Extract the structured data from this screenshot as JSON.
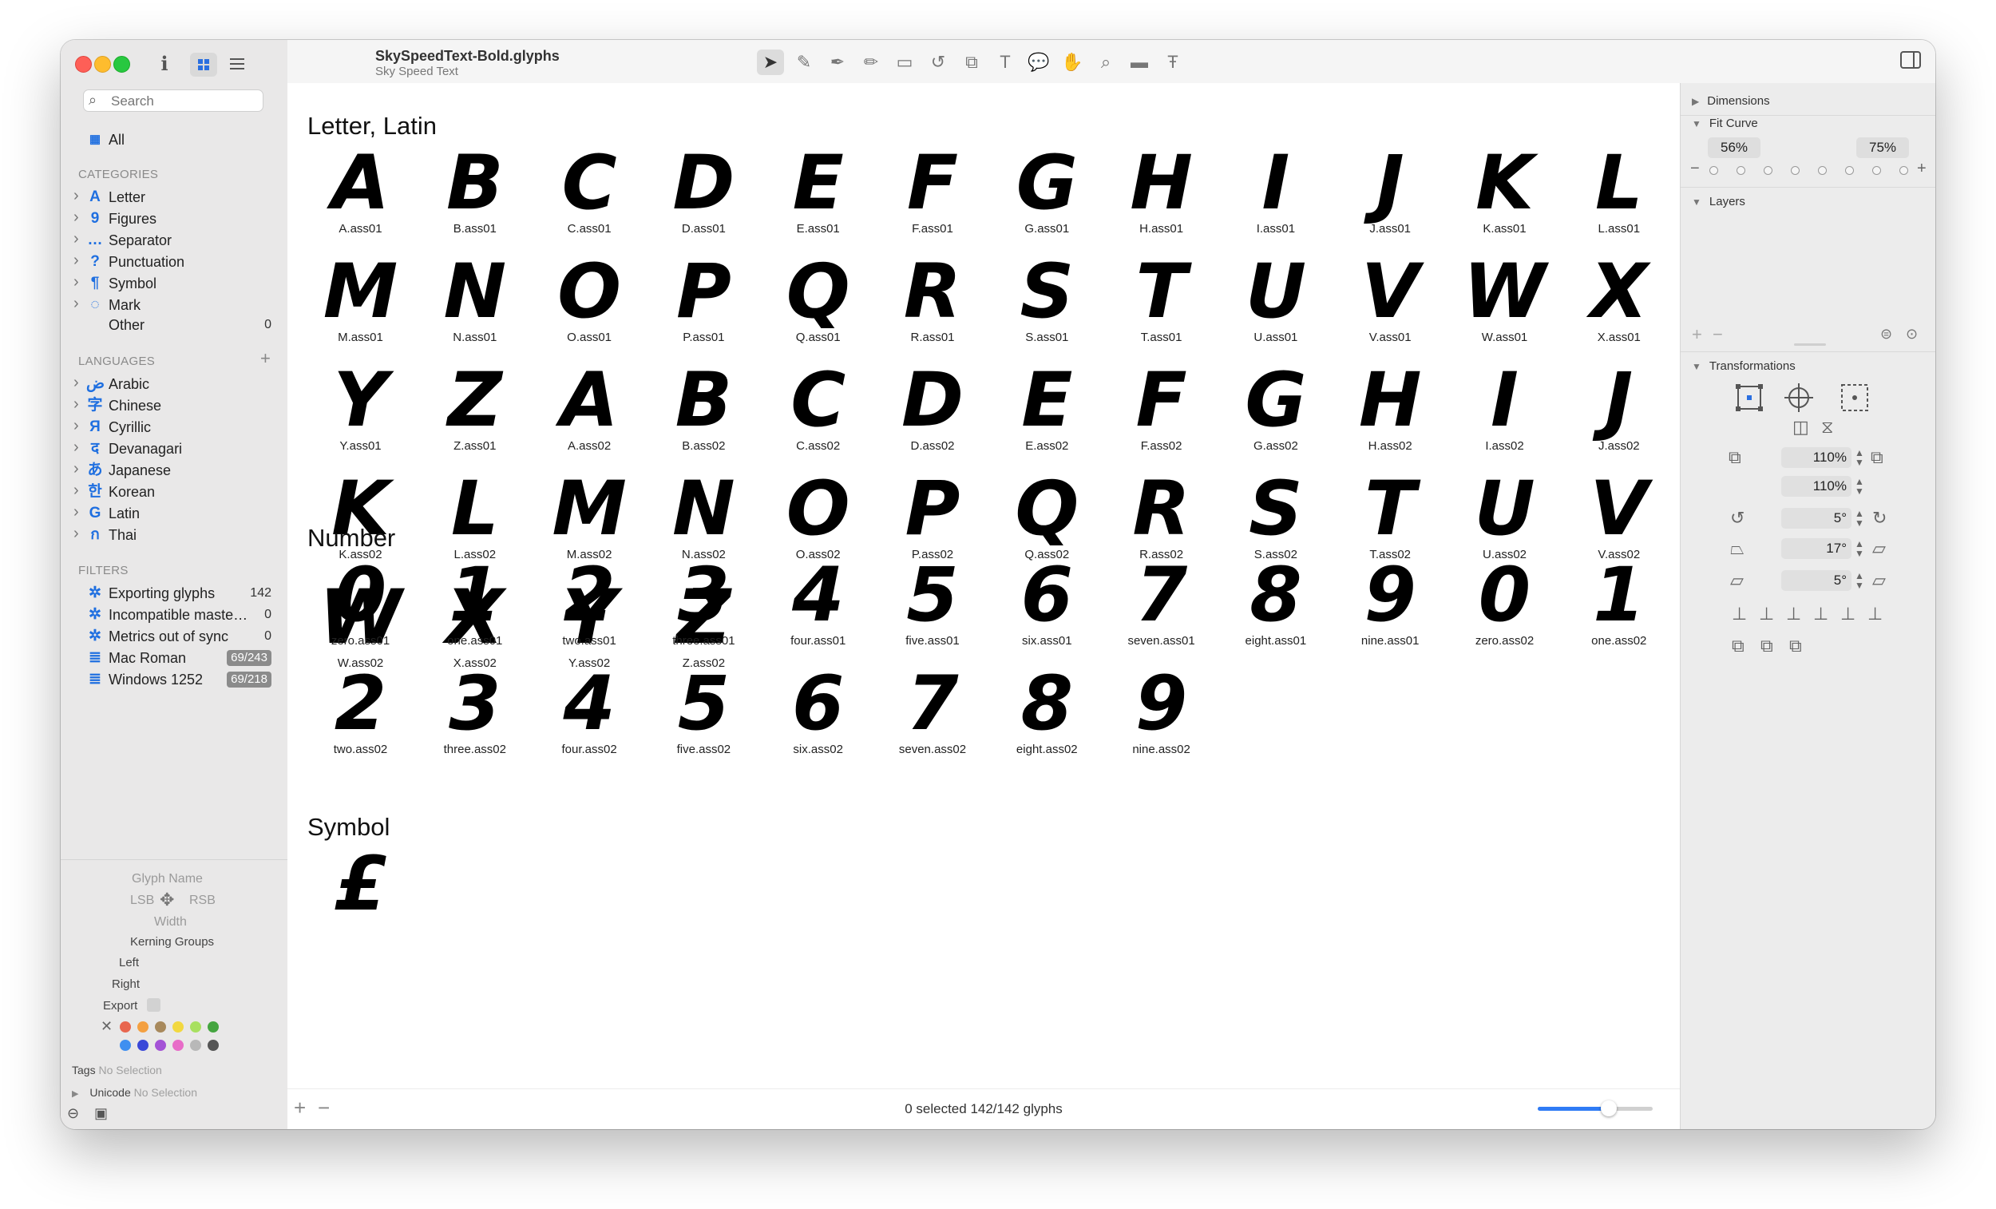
{
  "window": {
    "file_title": "SkySpeedText-Bold.glyphs",
    "font_name": "Sky Speed Text"
  },
  "sidebar": {
    "search_placeholder": "Search",
    "all_label": "All",
    "categories_heading": "CATEGORIES",
    "categories": [
      {
        "icon": "A",
        "label": "Letter",
        "icon_name": "letter-icon"
      },
      {
        "icon": "9",
        "label": "Figures",
        "icon_name": "figures-icon"
      },
      {
        "icon": "…",
        "label": "Separator",
        "icon_name": "separator-icon"
      },
      {
        "icon": "?",
        "label": "Punctuation",
        "icon_name": "punctuation-icon"
      },
      {
        "icon": "¶",
        "label": "Symbol",
        "icon_name": "symbol-icon"
      },
      {
        "icon": "◌",
        "label": "Mark",
        "icon_name": "mark-icon"
      }
    ],
    "other_label": "Other",
    "other_count": "0",
    "languages_heading": "LANGUAGES",
    "languages": [
      {
        "icon": "ض",
        "label": "Arabic"
      },
      {
        "icon": "字",
        "label": "Chinese"
      },
      {
        "icon": "Я",
        "label": "Cyrillic"
      },
      {
        "icon": "द",
        "label": "Devanagari"
      },
      {
        "icon": "あ",
        "label": "Japanese"
      },
      {
        "icon": "한",
        "label": "Korean"
      },
      {
        "icon": "G",
        "label": "Latin"
      },
      {
        "icon": "ก",
        "label": "Thai"
      }
    ],
    "filters_heading": "FILTERS",
    "filters": [
      {
        "label": "Exporting glyphs",
        "count": "142",
        "type": "count"
      },
      {
        "label": "Incompatible maste…",
        "count": "0",
        "type": "count"
      },
      {
        "label": "Metrics out of sync",
        "count": "0",
        "type": "count"
      },
      {
        "label": "Mac Roman",
        "count": "69/243",
        "type": "badge"
      },
      {
        "label": "Windows 1252",
        "count": "69/218",
        "type": "badge"
      }
    ],
    "info": {
      "glyph_name": "Glyph Name",
      "lsb": "LSB",
      "rsb": "RSB",
      "width": "Width",
      "kerning_groups": "Kerning Groups",
      "left": "Left",
      "right": "Right",
      "export": "Export",
      "tags_label": "Tags",
      "tags_value": "No Selection",
      "unicode_label": "Unicode",
      "unicode_value": "No Selection"
    },
    "color_labels": [
      "#e8664f",
      "#f4a041",
      "#a8895c",
      "#f2d840",
      "#a8e060",
      "#45a540",
      "#3f8ff0",
      "#3a48d8",
      "#a452d6",
      "#e86cc8",
      "#b8b8b8",
      "#555555"
    ]
  },
  "toolbar": {
    "tools": [
      "select-tool-icon",
      "select-all-layers-icon",
      "draw-tool-icon",
      "pencil-tool-icon",
      "primitives-icon",
      "rotate-icon",
      "scale-icon",
      "text-tool-icon",
      "annotation-icon",
      "hand-tool-icon",
      "zoom-icon",
      "measure-icon",
      "type-text-icon"
    ]
  },
  "main": {
    "categories": [
      {
        "title": "Letter, Latin",
        "glyphs": [
          {
            "char": "A",
            "name": "A.ass01"
          },
          {
            "char": "B",
            "name": "B.ass01"
          },
          {
            "char": "C",
            "name": "C.ass01"
          },
          {
            "char": "D",
            "name": "D.ass01"
          },
          {
            "char": "E",
            "name": "E.ass01"
          },
          {
            "char": "F",
            "name": "F.ass01"
          },
          {
            "char": "G",
            "name": "G.ass01"
          },
          {
            "char": "H",
            "name": "H.ass01"
          },
          {
            "char": "I",
            "name": "I.ass01"
          },
          {
            "char": "J",
            "name": "J.ass01"
          },
          {
            "char": "K",
            "name": "K.ass01"
          },
          {
            "char": "L",
            "name": "L.ass01"
          },
          {
            "char": "M",
            "name": "M.ass01"
          },
          {
            "char": "N",
            "name": "N.ass01"
          },
          {
            "char": "O",
            "name": "O.ass01"
          },
          {
            "char": "P",
            "name": "P.ass01"
          },
          {
            "char": "Q",
            "name": "Q.ass01"
          },
          {
            "char": "R",
            "name": "R.ass01"
          },
          {
            "char": "S",
            "name": "S.ass01"
          },
          {
            "char": "T",
            "name": "T.ass01"
          },
          {
            "char": "U",
            "name": "U.ass01"
          },
          {
            "char": "V",
            "name": "V.ass01"
          },
          {
            "char": "W",
            "name": "W.ass01"
          },
          {
            "char": "X",
            "name": "X.ass01"
          },
          {
            "char": "Y",
            "name": "Y.ass01"
          },
          {
            "char": "Z",
            "name": "Z.ass01"
          },
          {
            "char": "A",
            "name": "A.ass02"
          },
          {
            "char": "B",
            "name": "B.ass02"
          },
          {
            "char": "C",
            "name": "C.ass02"
          },
          {
            "char": "D",
            "name": "D.ass02"
          },
          {
            "char": "E",
            "name": "E.ass02"
          },
          {
            "char": "F",
            "name": "F.ass02"
          },
          {
            "char": "G",
            "name": "G.ass02"
          },
          {
            "char": "H",
            "name": "H.ass02"
          },
          {
            "char": "I",
            "name": "I.ass02"
          },
          {
            "char": "J",
            "name": "J.ass02"
          },
          {
            "char": "K",
            "name": "K.ass02"
          },
          {
            "char": "L",
            "name": "L.ass02"
          },
          {
            "char": "M",
            "name": "M.ass02"
          },
          {
            "char": "N",
            "name": "N.ass02"
          },
          {
            "char": "O",
            "name": "O.ass02"
          },
          {
            "char": "P",
            "name": "P.ass02"
          },
          {
            "char": "Q",
            "name": "Q.ass02"
          },
          {
            "char": "R",
            "name": "R.ass02"
          },
          {
            "char": "S",
            "name": "S.ass02"
          },
          {
            "char": "T",
            "name": "T.ass02"
          },
          {
            "char": "U",
            "name": "U.ass02"
          },
          {
            "char": "V",
            "name": "V.ass02"
          },
          {
            "char": "W",
            "name": "W.ass02"
          },
          {
            "char": "X",
            "name": "X.ass02"
          },
          {
            "char": "Y",
            "name": "Y.ass02"
          },
          {
            "char": "Z",
            "name": "Z.ass02"
          }
        ]
      },
      {
        "title": "Number",
        "glyphs": [
          {
            "char": "0",
            "name": "zero.ass01"
          },
          {
            "char": "1",
            "name": "one.ass01"
          },
          {
            "char": "2",
            "name": "two.ass01"
          },
          {
            "char": "3",
            "name": "three.ass01"
          },
          {
            "char": "4",
            "name": "four.ass01"
          },
          {
            "char": "5",
            "name": "five.ass01"
          },
          {
            "char": "6",
            "name": "six.ass01"
          },
          {
            "char": "7",
            "name": "seven.ass01"
          },
          {
            "char": "8",
            "name": "eight.ass01"
          },
          {
            "char": "9",
            "name": "nine.ass01"
          },
          {
            "char": "0",
            "name": "zero.ass02"
          },
          {
            "char": "1",
            "name": "one.ass02"
          },
          {
            "char": "2",
            "name": "two.ass02"
          },
          {
            "char": "3",
            "name": "three.ass02"
          },
          {
            "char": "4",
            "name": "four.ass02"
          },
          {
            "char": "5",
            "name": "five.ass02"
          },
          {
            "char": "6",
            "name": "six.ass02"
          },
          {
            "char": "7",
            "name": "seven.ass02"
          },
          {
            "char": "8",
            "name": "eight.ass02"
          },
          {
            "char": "9",
            "name": "nine.ass02"
          }
        ]
      },
      {
        "title": "Symbol",
        "glyphs": [
          {
            "char": "£",
            "name": ""
          }
        ]
      }
    ]
  },
  "status": {
    "selection_text": "0 selected 142/142 glyphs",
    "zoom_fraction": 0.62
  },
  "inspector": {
    "dimensions": "Dimensions",
    "fit_curve": "Fit Curve",
    "fit_low": "56%",
    "fit_high": "75%",
    "layers": "Layers",
    "transformations": "Transformations",
    "scale_x": "110%",
    "scale_y": "110%",
    "rotate": "5°",
    "slant": "17°",
    "skew": "5°"
  }
}
